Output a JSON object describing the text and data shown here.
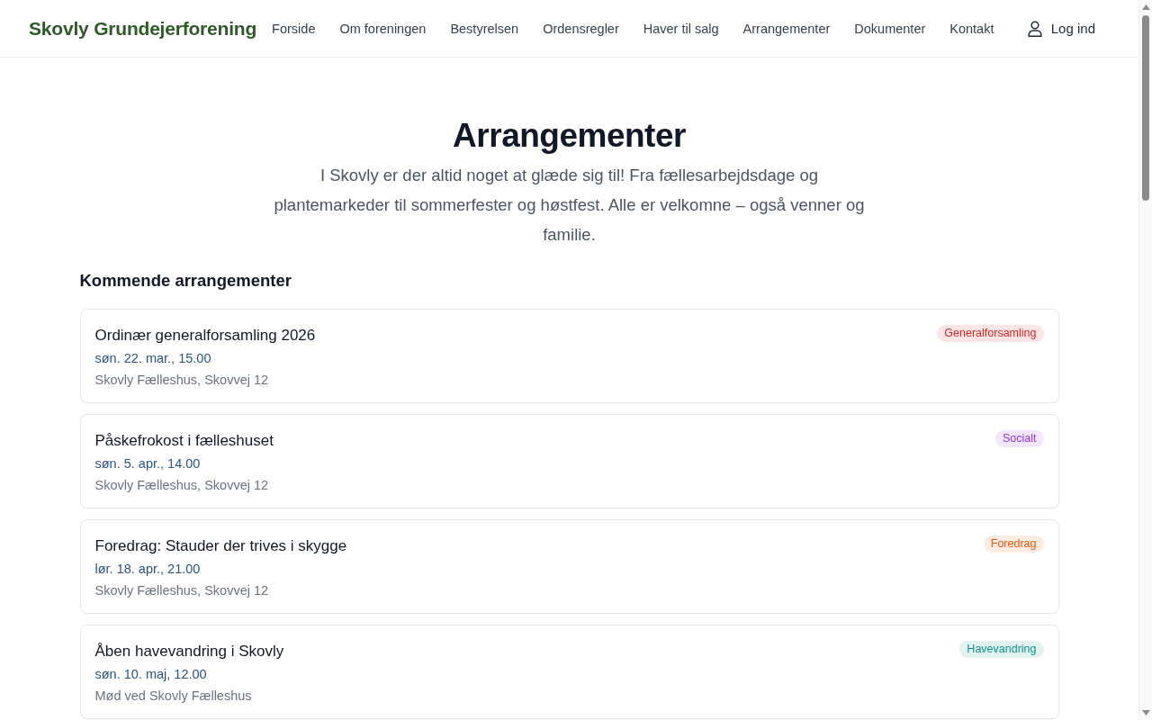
{
  "header": {
    "logo": "Skovly Grundejerforening",
    "nav": [
      "Forside",
      "Om foreningen",
      "Bestyrelsen",
      "Ordensregler",
      "Haver til salg",
      "Arrangementer",
      "Dokumenter",
      "Kontakt"
    ],
    "login": "Log ind"
  },
  "hero": {
    "title": "Arrangementer",
    "intro": "I Skovly er der altid noget at glæde sig til! Fra fællesarbejdsdage og plantemarkeder til sommerfester og høstfest. Alle er velkomne – også venner og familie."
  },
  "upcoming": {
    "heading": "Kommende arrangementer",
    "events": [
      {
        "title": "Ordinær generalforsamling 2026",
        "date": "søn. 22. mar., 15.00",
        "location": "Skovly Fælleshus, Skovvej 12",
        "category": {
          "label": "Generalforsamling",
          "color": "#dc2626"
        }
      },
      {
        "title": "Påskefrokost i fælleshuset",
        "date": "søn. 5. apr., 14.00",
        "location": "Skovly Fælleshus, Skovvej 12",
        "category": {
          "label": "Socialt",
          "color": "#9333ea"
        }
      },
      {
        "title": "Foredrag: Stauder der trives i skygge",
        "date": "lør. 18. apr., 21.00",
        "location": "Skovly Fælleshus, Skovvej 12",
        "category": {
          "label": "Foredrag",
          "color": "#ea580c"
        }
      },
      {
        "title": "Åben havevandring i Skovly",
        "date": "søn. 10. maj, 12.00",
        "location": "Mød ved Skovly Fælleshus",
        "category": {
          "label": "Havevandring",
          "color": "#0d9488"
        }
      }
    ]
  }
}
